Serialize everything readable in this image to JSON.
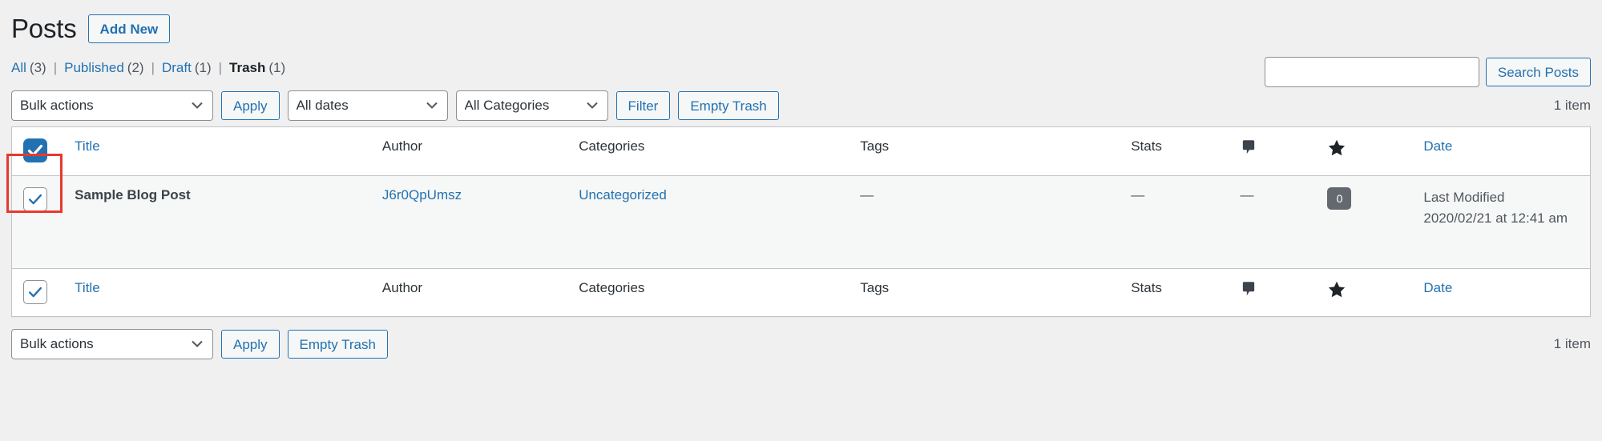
{
  "page": {
    "title": "Posts",
    "add_new_label": "Add New"
  },
  "status_links": [
    {
      "label": "All",
      "count": "(3)",
      "current": false
    },
    {
      "label": "Published",
      "count": "(2)",
      "current": false
    },
    {
      "label": "Draft",
      "count": "(1)",
      "current": false
    },
    {
      "label": "Trash",
      "count": "(1)",
      "current": true
    }
  ],
  "search": {
    "value": "",
    "placeholder": "",
    "button_label": "Search Posts"
  },
  "tablenav_top": {
    "bulk_actions_selected": "Bulk actions",
    "apply_label": "Apply",
    "dates_selected": "All dates",
    "categories_selected": "All Categories",
    "filter_label": "Filter",
    "empty_trash_label": "Empty Trash",
    "displaying_num": "1 item"
  },
  "tablenav_bottom": {
    "bulk_actions_selected": "Bulk actions",
    "apply_label": "Apply",
    "empty_trash_label": "Empty Trash",
    "displaying_num": "1 item"
  },
  "table": {
    "columns": {
      "title": "Title",
      "author": "Author",
      "categories": "Categories",
      "tags": "Tags",
      "stats": "Stats",
      "comments_icon": "comment-bubble-icon",
      "star_icon": "star-icon",
      "date": "Date"
    },
    "rows": [
      {
        "selected": true,
        "title": "Sample Blog Post",
        "author": "J6r0QpUmsz",
        "categories": "Uncategorized",
        "tags": "—",
        "stats": "—",
        "star": "—",
        "comment_count": "0",
        "date_label": "Last Modified",
        "date_value": "2020/02/21 at 12:41 am"
      }
    ],
    "select_all_checked": true
  },
  "colors": {
    "accent": "#2271b1",
    "highlight": "#e8392e",
    "badge": "#646970",
    "row_bg": "#f6f7f7",
    "page_bg": "#f0f0f1"
  },
  "annotation": {
    "target": "select-all-checkbox-header"
  }
}
